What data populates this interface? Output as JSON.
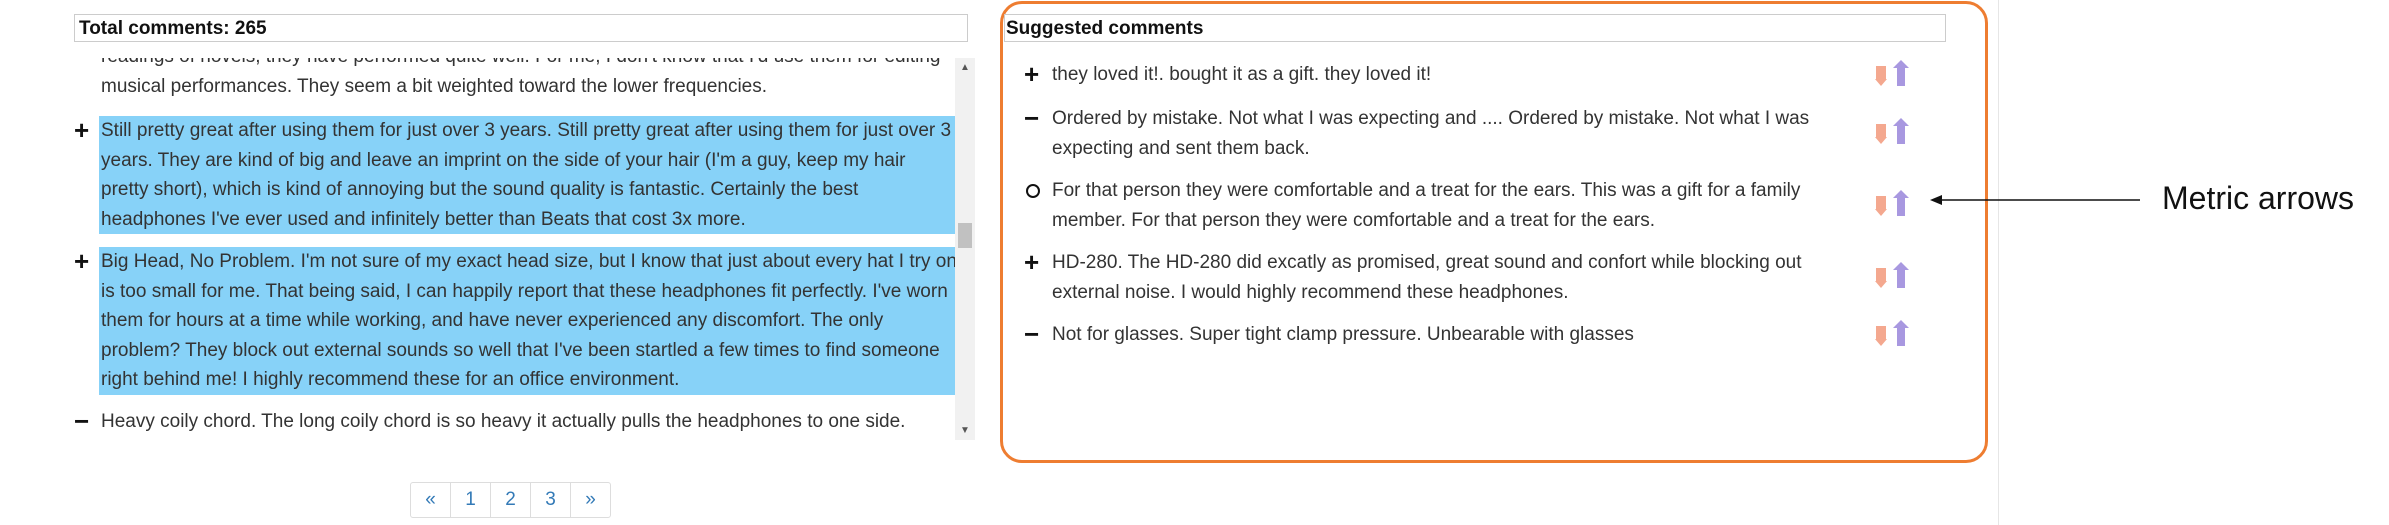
{
  "left": {
    "header": "Total comments: 265",
    "comments": [
      {
        "sign": "",
        "selected": false,
        "text": "readings of novels, they have performed quite well. For me, I don't know that I'd use them for editing musical performances. They seem a bit weighted toward the lower frequencies."
      },
      {
        "sign": "+",
        "selected": true,
        "text": "Still pretty great after using them for just over 3 years. Still pretty great after using them for just over 3 years. They are kind of big and leave an imprint on the side of your hair (I'm a guy, keep my hair pretty short), which is kind of annoying but the sound quality is fantastic. Certainly the best headphones I've ever used and infinitely better than Beats that cost 3x more."
      },
      {
        "sign": "+",
        "selected": true,
        "text": "Big Head, No Problem. I'm not sure of my exact head size, but I know that just about every hat I try on is too small for me. That being said, I can happily report that these headphones fit perfectly. I've worn them for hours at a time while working, and have never experienced any discomfort. The only problem? They block out external sounds so well that I've been startled a few times to find someone right behind me! I highly recommend these for an office environment."
      },
      {
        "sign": "−",
        "selected": false,
        "text": "Heavy coily chord. The long coily chord is so heavy it actually pulls the headphones to one side."
      }
    ],
    "scroll_up": "▲",
    "scroll_down": "▼"
  },
  "pagination": [
    "«",
    "1",
    "2",
    "3",
    "»"
  ],
  "right": {
    "header": "Suggested comments",
    "items": [
      {
        "sign": "+",
        "text": "they loved it!. bought it as a gift. they loved it!"
      },
      {
        "sign": "−",
        "text": "Ordered by mistake. Not what I was expecting and .... Ordered by mistake. Not what I was expecting and sent them back."
      },
      {
        "sign": "circle",
        "text": "For that person they were comfortable and a treat for the ears. This was a gift for a family member. For that person they were comfortable and a treat for the ears."
      },
      {
        "sign": "+",
        "text": "HD-280. The HD-280 did excatly as promised, great sound and confort while blocking out external noise. I would highly recommend these headphones."
      },
      {
        "sign": "−",
        "text": "Not for glasses. Super tight clamp pressure. Unbearable with glasses"
      }
    ],
    "metric_icons": {
      "down": "down-arrow-icon",
      "up": "up-arrow-icon"
    }
  },
  "annotation": "Metric arrows",
  "colors": {
    "selection": "#87d2f8",
    "outline": "#ee7d31",
    "down_arrow": "#f4a88f",
    "up_arrow": "#a898e0",
    "link": "#337ab7"
  }
}
